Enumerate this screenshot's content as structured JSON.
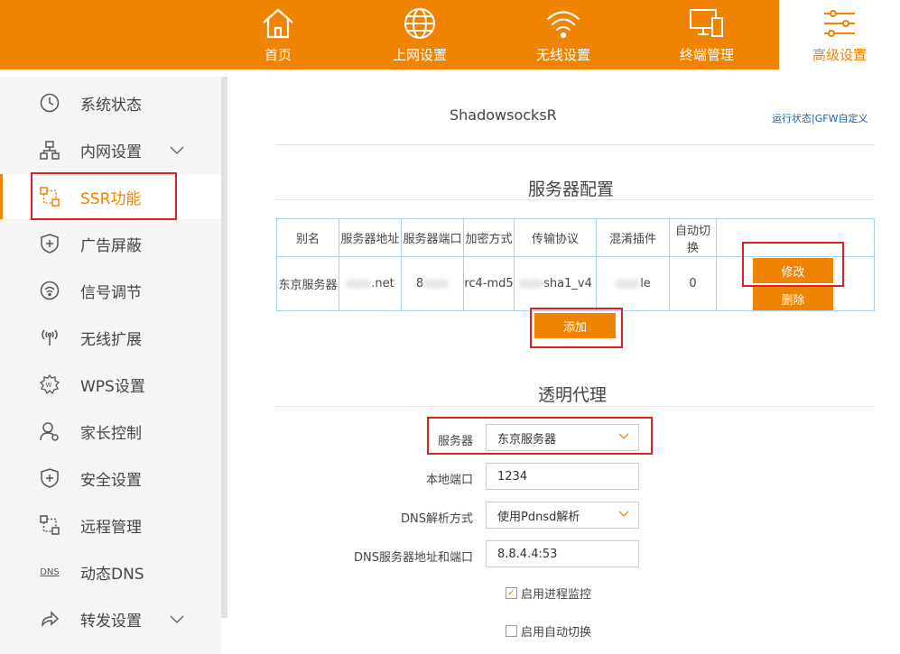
{
  "nav": [
    {
      "label": "首页",
      "icon": "home-icon"
    },
    {
      "label": "上网设置",
      "icon": "globe-icon"
    },
    {
      "label": "无线设置",
      "icon": "wifi-icon"
    },
    {
      "label": "终端管理",
      "icon": "devices-icon"
    },
    {
      "label": "高级设置",
      "icon": "sliders-icon",
      "active": true
    }
  ],
  "sidebar": {
    "items": [
      {
        "label": "系统状态",
        "icon": "clock-icon"
      },
      {
        "label": "内网设置",
        "icon": "network-icon",
        "expandable": true
      },
      {
        "label": "SSR功能",
        "icon": "ssr-icon",
        "active": true
      },
      {
        "label": "广告屏蔽",
        "icon": "shield-plus-icon"
      },
      {
        "label": "信号调节",
        "icon": "signal-icon"
      },
      {
        "label": "无线扩展",
        "icon": "wireless-extend-icon"
      },
      {
        "label": "WPS设置",
        "icon": "wps-icon"
      },
      {
        "label": "家长控制",
        "icon": "parent-icon"
      },
      {
        "label": "安全设置",
        "icon": "security-icon"
      },
      {
        "label": "远程管理",
        "icon": "remote-icon"
      },
      {
        "label": "动态DNS",
        "icon": "dns-icon",
        "icon_text": "DNS"
      },
      {
        "label": "转发设置",
        "icon": "forward-icon",
        "expandable": true
      }
    ]
  },
  "page": {
    "title": "ShadowsocksR",
    "links": [
      "运行状态",
      "GFW自定义"
    ],
    "link_sep": "|"
  },
  "server_config": {
    "heading": "服务器配置",
    "columns": [
      "别名",
      "服务器地址",
      "服务器端口",
      "加密方式",
      "传输协议",
      "混淆插件",
      "自动切换"
    ],
    "rows": [
      {
        "alias": "东京服务器",
        "address": ".net",
        "port": "8",
        "encryption": "rc4-md5",
        "protocol": "sha1_v4",
        "obfs": "le",
        "auto_switch": "0"
      }
    ],
    "edit_label": "修改",
    "delete_label": "删除",
    "add_label": "添加"
  },
  "proxy": {
    "heading": "透明代理",
    "server_label": "服务器",
    "server_value": "东京服务器",
    "local_port_label": "本地端口",
    "local_port_value": "1234",
    "dns_mode_label": "DNS解析方式",
    "dns_mode_value": "使用Pdnsd解析",
    "dns_server_label": "DNS服务器地址和端口",
    "dns_server_value": "8.8.4.4:53",
    "monitor_label": "启用进程监控",
    "monitor_checked": true,
    "autoswitch_label": "启用自动切换",
    "autoswitch_checked": false
  },
  "colors": {
    "accent": "#f08300",
    "highlight_box": "#e02020",
    "table_border": "#a8d4ea",
    "link": "#1a5fb4"
  }
}
